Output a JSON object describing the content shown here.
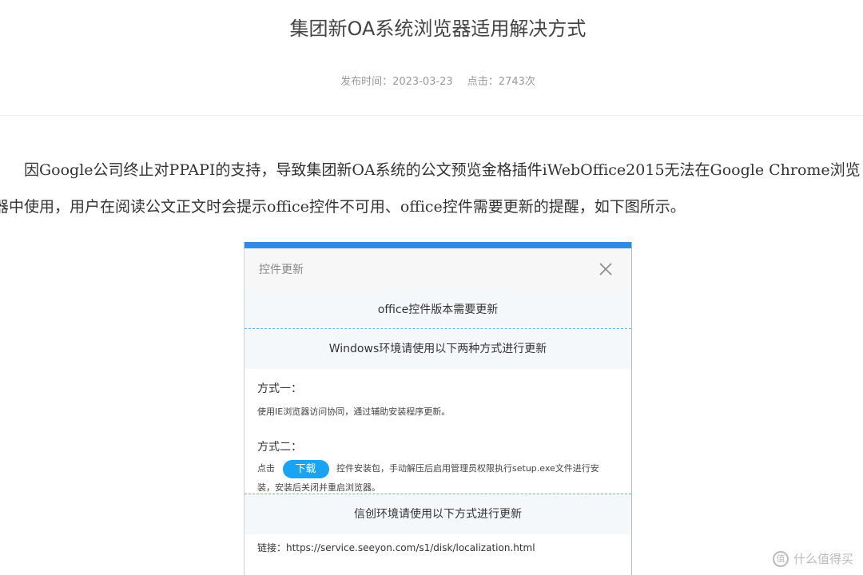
{
  "article": {
    "title": "集团新OA系统浏览器适用解决方式",
    "publish_time": "发布时间：2023-03-23",
    "clicks": "点击：2743次",
    "paragraph_line1": "因Google公司终止对PPAPI的支持，导致集团新OA系统的公文预览金格插件iWebOffice2015无法在Google Chrome浏览",
    "paragraph_line2": "器中使用，用户在阅读公文正文时会提示office控件不可用、office控件需要更新的提醒，如下图所示。"
  },
  "dialog": {
    "title": "控件更新",
    "notice": "office控件版本需要更新",
    "windows_heading": "Windows环境请使用以下两种方式进行更新",
    "method1_heading": "方式一：",
    "method1_text": "使用IE浏览器访问协同，通过辅助安装程序更新。",
    "method2_heading": "方式二：",
    "method2_prefix": "点击",
    "download_label": "下载",
    "method2_suffix": "控件安装包，手动解压后启用管理员权限执行setup.exe文件进行安",
    "method2_suffix2": "装，安装后关闭并重启浏览器。",
    "xinchuang_heading": "信创环境请使用以下方式进行更新",
    "link_text": "链接：https://service.seeyon.com/s1/disk/localization.html",
    "accent_color": "#2f8be6",
    "button_color": "#1aa3f2"
  },
  "watermark": {
    "text": "什么值得买",
    "logo_glyph": "值"
  }
}
